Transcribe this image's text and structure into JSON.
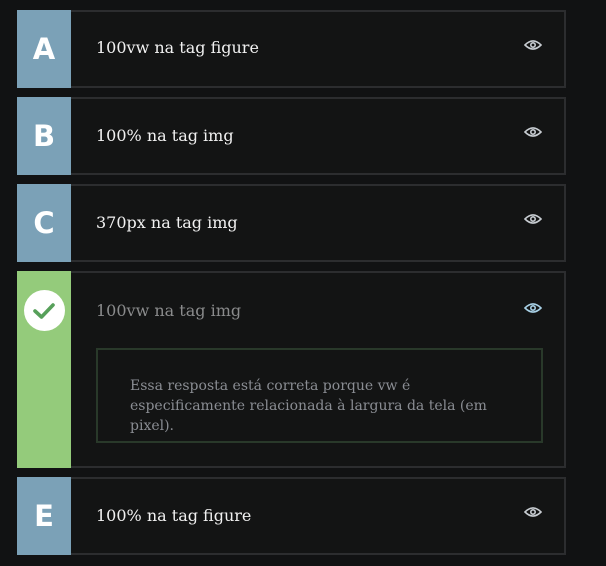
{
  "options": [
    {
      "letter": "A",
      "text": "100vw na tag figure"
    },
    {
      "letter": "B",
      "text": "100% na tag img"
    },
    {
      "letter": "C",
      "text": "370px na tag img"
    },
    {
      "letter": "",
      "text": "100vw na tag img",
      "correct": true,
      "icon": "check-icon",
      "feedback": "Essa resposta está correta porque vw é especificamente relacionada à largura da tela (em pixel)."
    },
    {
      "letter": "E",
      "text": "100% na tag figure"
    }
  ],
  "icons": {
    "eye": "eye-icon",
    "check": "check-icon"
  },
  "colors": {
    "badge_default": "#7ba1b7",
    "badge_correct": "#94cb7b",
    "background": "#111213",
    "border": "#2c2d2f",
    "feedback_border": "#29392a"
  }
}
